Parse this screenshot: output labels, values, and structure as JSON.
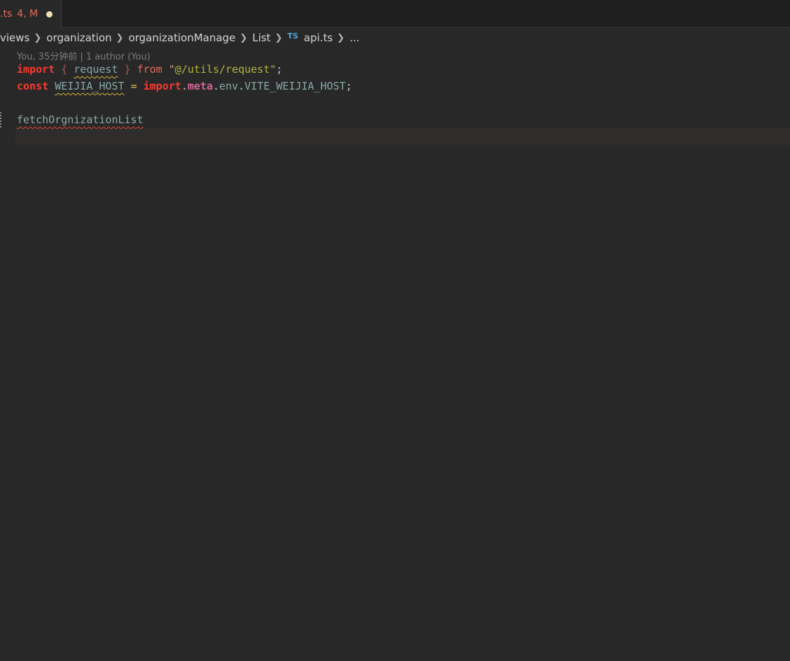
{
  "tab": {
    "file_name": ".ts",
    "status": "4, M"
  },
  "breadcrumb": {
    "items": [
      "views",
      "organization",
      "organizationManage",
      "List"
    ],
    "ts_icon": "TS",
    "file": "api.ts",
    "ellipsis": "..."
  },
  "codelens": "You, 35分钟前 | 1 author (You)",
  "code": {
    "line1": {
      "import": "import",
      "brace_open": "{",
      "request": "request",
      "brace_close": "}",
      "from": "from",
      "quote_open": "\"",
      "path": "@/utils/request",
      "quote_close": "\"",
      "semi": ";"
    },
    "line2": {
      "const": "const",
      "name": "WEIJIA_HOST",
      "eq": "=",
      "import": "import",
      "dot1": ".",
      "meta": "meta",
      "dot2": ".",
      "env": "env",
      "dot3": ".",
      "var": "VITE_WEIJIA_HOST",
      "semi": ";"
    },
    "line4": {
      "identifier": "fetchOrgnizationList"
    }
  },
  "colors": {
    "background": "#282828",
    "keyword": "#fa3a2f",
    "tab_modified": "#e7695a",
    "string": "#b3b23e",
    "identifier": "#88a8a6",
    "warning_squiggle": "#d7b43a",
    "error_squiggle": "#e0443a"
  }
}
